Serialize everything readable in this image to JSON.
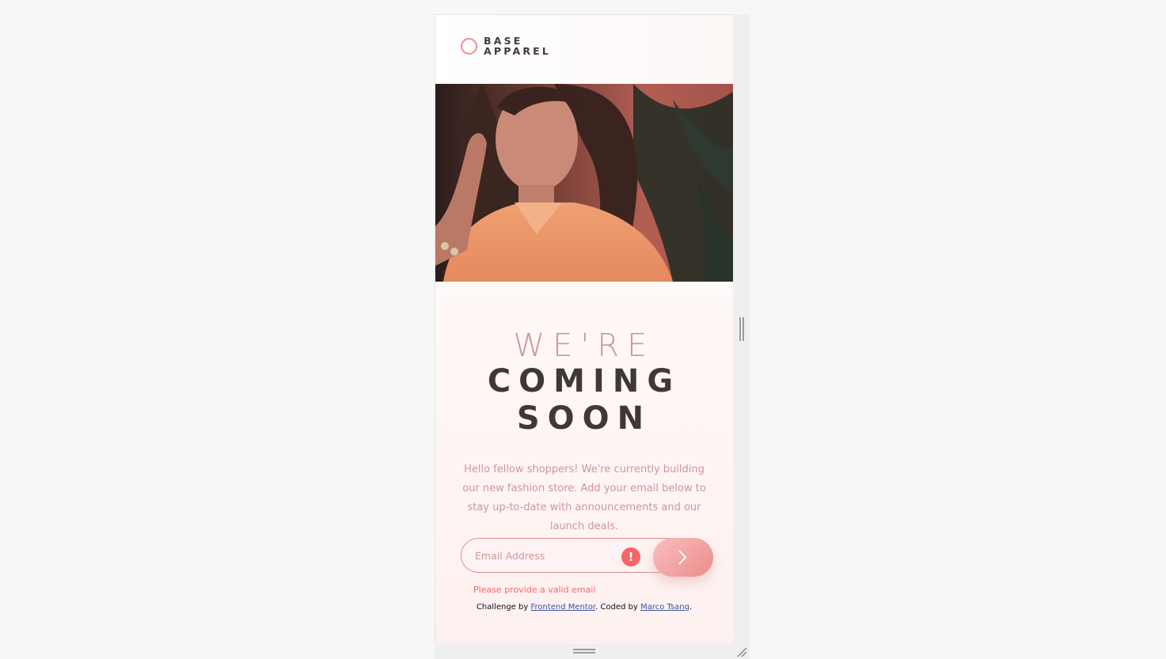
{
  "brand": {
    "line1": "BASE",
    "line2": "APPAREL"
  },
  "hero": {
    "alt": "Woman in an orange shirt in front of tropical leaves"
  },
  "headline": {
    "line1": "WE'RE",
    "line2": "COMING",
    "line3": "SOON"
  },
  "intro": "Hello fellow shoppers! We're currently building our new fashion store. Add your email below to stay up-to-date with announcements and our launch deals.",
  "form": {
    "email_placeholder": "Email Address",
    "error_icon": "!",
    "error_message": "Please provide a valid email",
    "submit_icon": "chevron-right-icon"
  },
  "attribution": {
    "prefix": "Challenge by ",
    "link1": "Frontend Mentor",
    "middle": ". Coded by ",
    "link2": "Marco Tsang",
    "suffix": "."
  },
  "colors": {
    "accent": "#f08c8c",
    "error": "#f96464",
    "desaturated_red": "#ce9797",
    "dark_grayish_red": "#423a3a"
  }
}
